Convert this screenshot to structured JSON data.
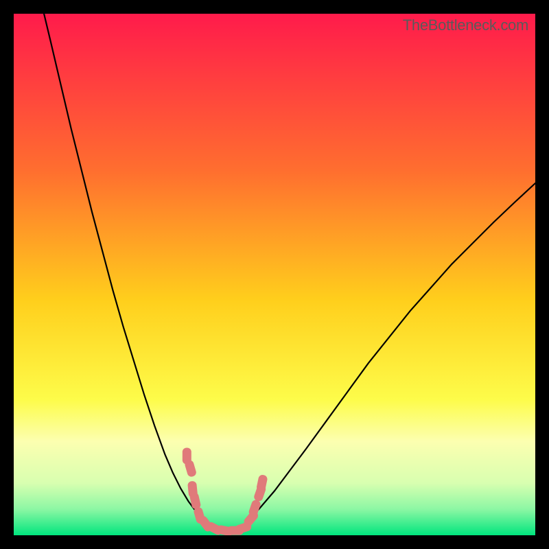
{
  "watermark": "TheBottleneck.com",
  "chart_data": {
    "type": "line",
    "title": "",
    "xlabel": "",
    "ylabel": "",
    "xlim": [
      0,
      100
    ],
    "ylim": [
      0,
      100
    ],
    "grid": false,
    "legend": false,
    "background_gradient": {
      "stops": [
        {
          "offset": 0,
          "color": "#ff1b4b"
        },
        {
          "offset": 0.3,
          "color": "#ff6e2f"
        },
        {
          "offset": 0.55,
          "color": "#ffcf1c"
        },
        {
          "offset": 0.74,
          "color": "#fdfc4a"
        },
        {
          "offset": 0.82,
          "color": "#fcffb0"
        },
        {
          "offset": 0.9,
          "color": "#d8ffb0"
        },
        {
          "offset": 0.95,
          "color": "#8cf7a4"
        },
        {
          "offset": 1.0,
          "color": "#00e57e"
        }
      ]
    },
    "series": [
      {
        "name": "curve-left",
        "x": [
          5.8,
          7,
          9,
          11,
          13,
          15,
          17,
          19,
          21,
          23,
          25,
          27,
          29,
          30.5,
          32,
          33.5,
          35,
          36.5
        ],
        "y": [
          100,
          95,
          86.5,
          78,
          70,
          62,
          54.5,
          47,
          40,
          33.5,
          27,
          21,
          15.5,
          12,
          9,
          6.5,
          4.5,
          3
        ]
      },
      {
        "name": "curve-right",
        "x": [
          45,
          47,
          50,
          53,
          56,
          60,
          64,
          68,
          72,
          76,
          80,
          84,
          88,
          92,
          96,
          100
        ],
        "y": [
          3,
          5,
          8.5,
          12.5,
          16.5,
          22,
          27.5,
          33,
          38,
          43,
          47.5,
          52,
          56,
          60,
          63.8,
          67.5
        ]
      }
    ],
    "markers": {
      "name": "dip-markers",
      "color": "#e07a7a",
      "points": [
        {
          "x": 33.2,
          "y": 15.2
        },
        {
          "x": 33.9,
          "y": 12.8
        },
        {
          "x": 34.3,
          "y": 8.8
        },
        {
          "x": 34.8,
          "y": 6.6
        },
        {
          "x": 35.6,
          "y": 3.8
        },
        {
          "x": 36.8,
          "y": 2.2
        },
        {
          "x": 38.5,
          "y": 1.3
        },
        {
          "x": 40.5,
          "y": 0.9
        },
        {
          "x": 42.5,
          "y": 0.9
        },
        {
          "x": 44.0,
          "y": 1.4
        },
        {
          "x": 45.5,
          "y": 3.2
        },
        {
          "x": 46.2,
          "y": 5.2
        },
        {
          "x": 47.2,
          "y": 8.1
        },
        {
          "x": 47.6,
          "y": 10.0
        }
      ]
    }
  }
}
